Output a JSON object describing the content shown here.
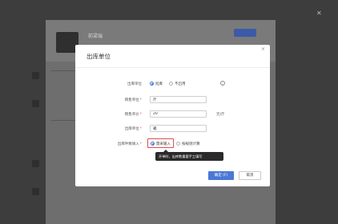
{
  "background": {
    "name": "前梁瑞"
  },
  "modal": {
    "title": "出库单位",
    "close_glyph": "×",
    "rows": {
      "outbound_unit": {
        "label": "出库单位",
        "options": [
          "批库",
          "不启用"
        ]
      },
      "sale_unit": {
        "label": "销售单位",
        "value": "斤"
      },
      "sale_price": {
        "label": "销售单价",
        "value": "20",
        "unit_note": "元/斤"
      },
      "outbound_unit_field": {
        "label": "出库单位",
        "value": "箱"
      },
      "outbound_count": {
        "label": "出库件数填入",
        "options": [
          "需采输入",
          "按规则计算"
        ]
      }
    },
    "tooltip": "开单时，出库数量要手工填写",
    "buttons": {
      "ok": "确定 (F)",
      "cancel": "取消"
    }
  },
  "colors": {
    "primary": "#4a78d6",
    "required": "#e34c4c",
    "highlight": "#e34c4c",
    "tooltip_bg": "#2a2a2a"
  }
}
